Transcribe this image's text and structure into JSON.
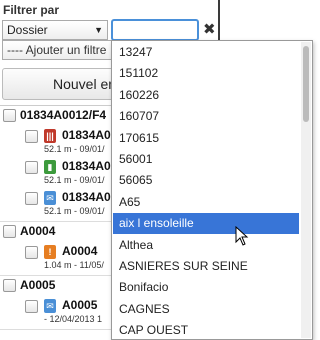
{
  "filter": {
    "label": "Filtrer par",
    "type_value": "Dossier",
    "search_value": "",
    "add_filter_label": "---- Ajouter un filtre"
  },
  "new_button_label": "Nouvel enregistrement",
  "tree": {
    "groups": [
      {
        "label": "01834A0012/F4",
        "children": [
          {
            "label": "01834A0",
            "sub": "52.1 m - 09/01/",
            "icon": "red-barcode-icon"
          },
          {
            "label": "01834A0",
            "sub": "52.1 m - 09/01/",
            "icon": "green-marker-icon"
          },
          {
            "label": "01834A0",
            "sub": "52.1 m - 09/01/",
            "icon": "blue-mail-icon"
          }
        ]
      },
      {
        "label": "A0004",
        "children": [
          {
            "label": "A0004",
            "sub": "1.04 m - 11/05/",
            "icon": "orange-pin-icon"
          }
        ]
      },
      {
        "label": "A0005",
        "children": [
          {
            "label": "A0005",
            "sub": "- 12/04/2013 1",
            "icon": "blue-mail-icon"
          }
        ]
      }
    ]
  },
  "dropdown": {
    "options": [
      "13247",
      "151102",
      "160226",
      "160707",
      "170615",
      "56001",
      "56065",
      "A65",
      "aix l ensoleille",
      "Althea",
      "ASNIERES SUR SEINE",
      "Bonifacio",
      "CAGNES",
      "CAP OUEST"
    ],
    "selected_index": 8
  },
  "colors": {
    "selection": "#3875d7",
    "focus_border": "#4a90d9"
  }
}
